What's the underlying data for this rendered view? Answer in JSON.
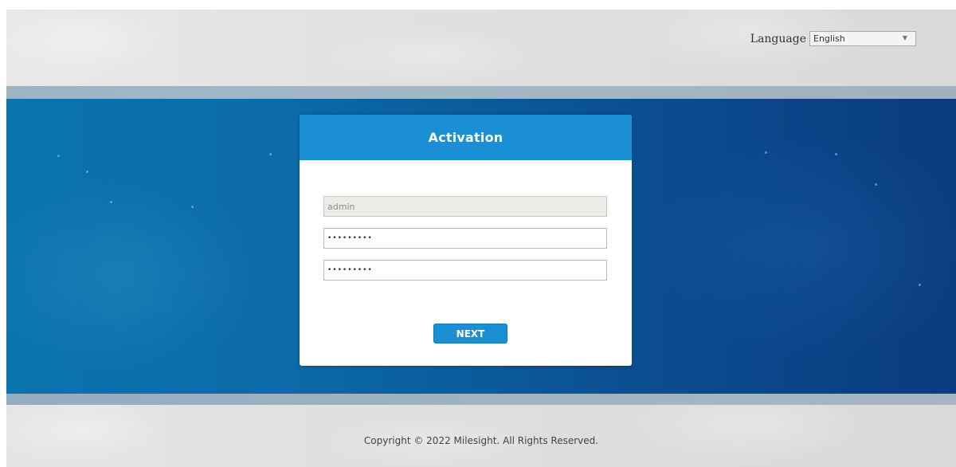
{
  "header": {
    "language_label": "Language",
    "language_selected": "English"
  },
  "dialog": {
    "title": "Activation",
    "username_value": "admin",
    "password_value": "•••••••••",
    "confirm_password_value": "•••••••••",
    "next_label": "NEXT"
  },
  "footer": {
    "copyright": "Copyright © 2022 Milesight. All Rights Reserved."
  },
  "colors": {
    "primary_blue": "#1a8fd3",
    "band_blue_left": "#0a74ad",
    "band_blue_right": "#0a3b7f"
  }
}
